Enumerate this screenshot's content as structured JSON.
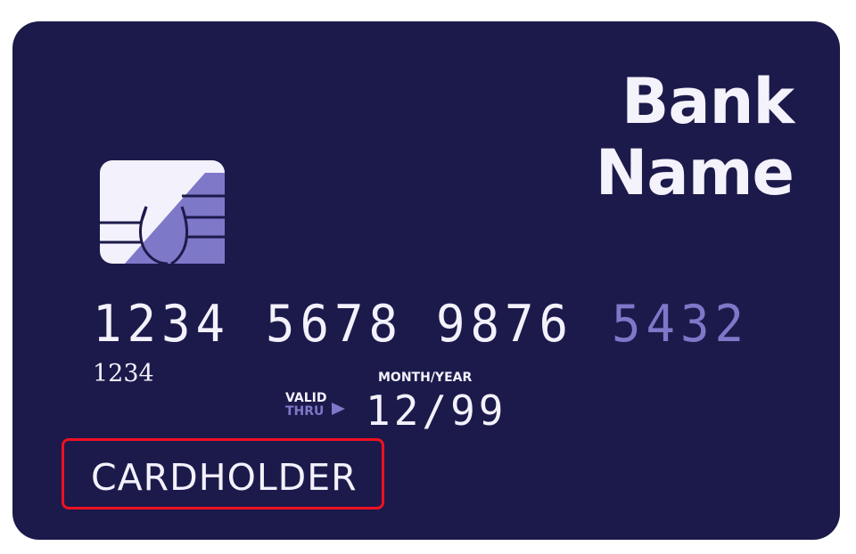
{
  "card": {
    "bank_name": "Bank Name",
    "number_groups": [
      "1234",
      "5678",
      "9876",
      "5432"
    ],
    "number_small": "1234",
    "month_year_label": "MONTH/YEAR",
    "valid_label_line1": "VALID",
    "valid_label_line2": "THRU",
    "expiry": "12/99",
    "cardholder": "CARDHOLDER"
  },
  "colors": {
    "card_background": "#1c1a4b",
    "text_light": "#f3f1fb",
    "accent": "#7e78c9",
    "highlight_border": "#ee1122",
    "page_background": "#ffffff"
  },
  "icons": [
    "chip-icon",
    "arrow-right-icon"
  ]
}
